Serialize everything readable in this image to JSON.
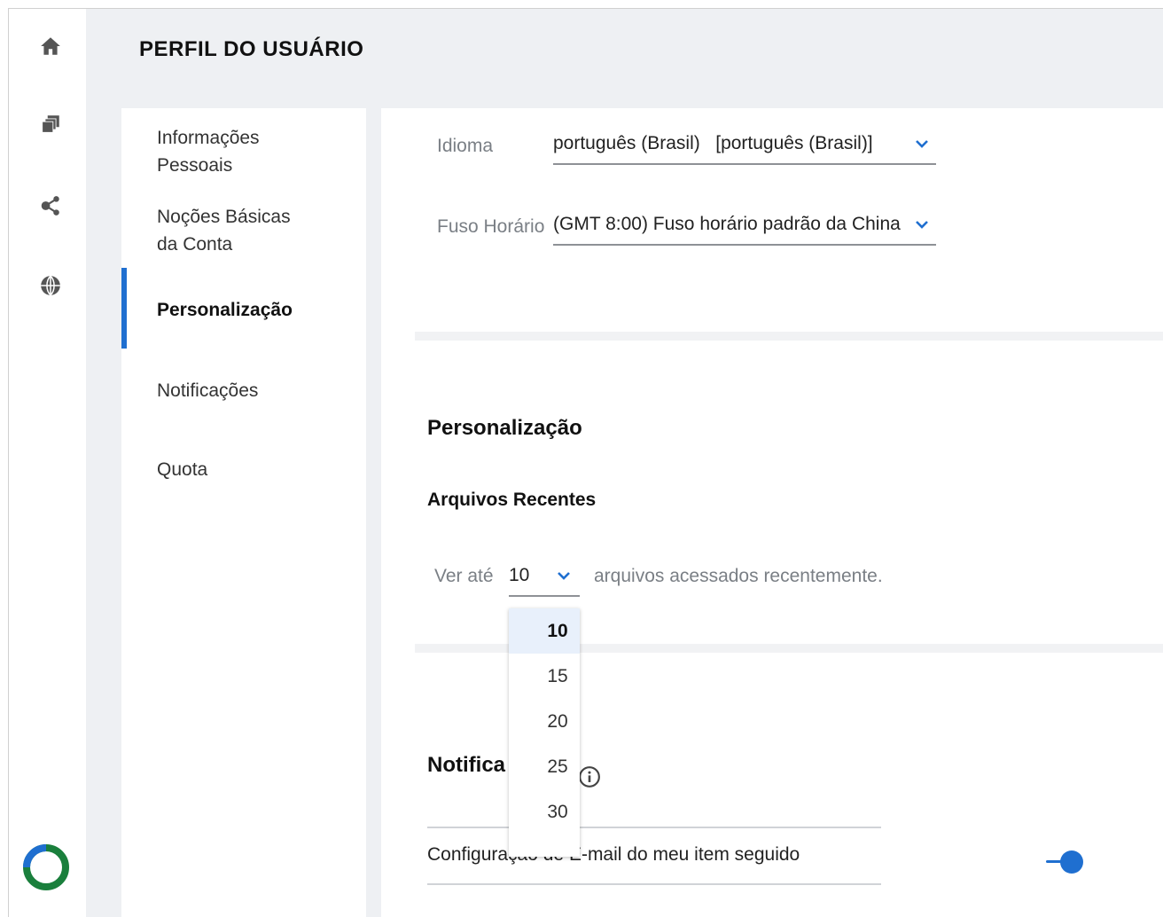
{
  "header": {
    "title": "PERFIL DO USUÁRIO"
  },
  "rail": {
    "items": [
      {
        "icon": "home-icon"
      },
      {
        "icon": "files-icon"
      },
      {
        "icon": "share-icon"
      },
      {
        "icon": "globe-icon"
      }
    ],
    "logo": "logo-ring-icon"
  },
  "nav": {
    "items": [
      {
        "label": "Informações\nPessoais"
      },
      {
        "label": "Noções Básicas\nda Conta"
      },
      {
        "label": "Personalização"
      },
      {
        "label": "Notificações"
      },
      {
        "label": "Quota"
      }
    ],
    "active_index": 2
  },
  "settings": {
    "language_label": "Idioma",
    "language_value": "português (Brasil)   [português (Brasil)]",
    "timezone_label": "Fuso Horário",
    "timezone_value": "(GMT 8:00) Fuso horário padrão da China"
  },
  "personalization": {
    "title": "Personalização",
    "recent_title": "Arquivos Recentes",
    "show_up_to": "Ver até",
    "selected_value": "10",
    "suffix": "arquivos acessados recentemente.",
    "options": [
      "10",
      "15",
      "20",
      "25",
      "30"
    ]
  },
  "notifications": {
    "title": "Notifica",
    "email_setting": "Configuração de E-mail do meu item seguido",
    "toggle_on": true
  },
  "colors": {
    "accent": "#1f6fd0",
    "logo_green": "#1a7f3c",
    "logo_blue": "#1f6fd0"
  }
}
